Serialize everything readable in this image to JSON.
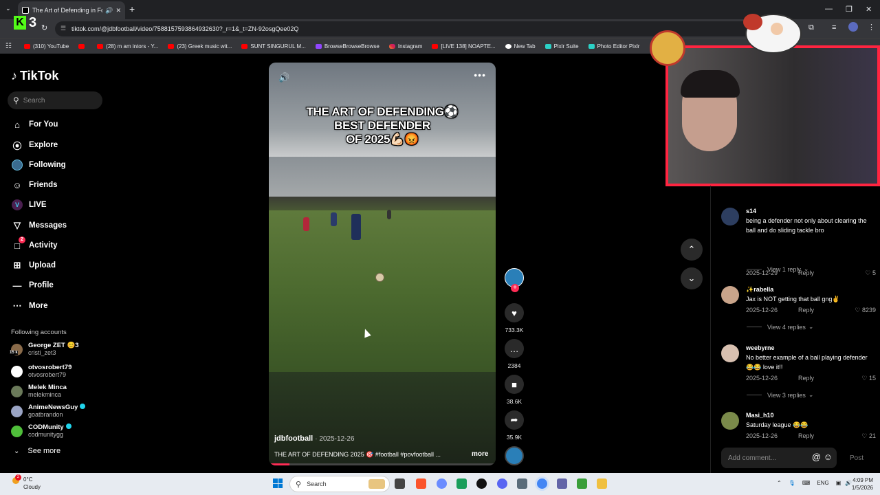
{
  "browser": {
    "tab_title": "The Art of Defending in Fo",
    "url": "tiktok.com/@jdbfootball/video/7588157593864932630?_r=1&_t=ZN-92osgQee02Q",
    "overlay_badge": "3",
    "bookmarks": [
      {
        "label": "(310) YouTube",
        "icon": "youtube-icon"
      },
      {
        "label": "",
        "icon": "youtube-icon"
      },
      {
        "label": "(28) m am intors - Y...",
        "icon": "youtube-icon"
      },
      {
        "label": "(23) Greek music wit...",
        "icon": "youtube-icon"
      },
      {
        "label": "SUNT SINGURUL M...",
        "icon": "youtube-icon"
      },
      {
        "label": "BrowseBrowseBrowse",
        "icon": "twitch-icon"
      },
      {
        "label": "Instagram",
        "icon": "instagram-icon"
      },
      {
        "label": "[LIVE 138] NOAPTE...",
        "icon": "youtube-icon"
      },
      {
        "label": "New Tab",
        "icon": "new-tab-icon"
      },
      {
        "label": "Pixlr Suite",
        "icon": "pixlr-icon"
      },
      {
        "label": "Photo Editor Pixlr",
        "icon": "pixlr-icon"
      }
    ]
  },
  "sidebar": {
    "logo": "TikTok",
    "search_placeholder": "Search",
    "nav": [
      {
        "label": "For You",
        "icon": "home-icon"
      },
      {
        "label": "Explore",
        "icon": "compass-icon"
      },
      {
        "label": "Following",
        "icon": "following-avatar"
      },
      {
        "label": "Friends",
        "icon": "friends-icon"
      },
      {
        "label": "LIVE",
        "icon": "live-icon"
      },
      {
        "label": "Messages",
        "icon": "messages-icon"
      },
      {
        "label": "Activity",
        "icon": "activity-icon",
        "badge": "2"
      },
      {
        "label": "Upload",
        "icon": "upload-icon"
      },
      {
        "label": "Profile",
        "icon": "profile-icon"
      },
      {
        "label": "More",
        "icon": "more-icon"
      }
    ],
    "following_title": "Following accounts",
    "accounts": [
      {
        "name": "George ZET 😊3",
        "handle": "cristi_zet3",
        "badge": "15 k"
      },
      {
        "name": "otvosrobert79",
        "handle": "otvosrobert79"
      },
      {
        "name": "Melek Minca",
        "handle": "melekminca"
      },
      {
        "name": "AnimeNewsGuy",
        "handle": "goatbrandon",
        "verified": true
      },
      {
        "name": "CODMunity",
        "handle": "codmunitygg",
        "verified": true
      }
    ],
    "see_more": "See more"
  },
  "video": {
    "title_lines": [
      "THE ART OF DEFENDING⚽",
      "BEST DEFENDER",
      "OF 2025💪🏻😡"
    ],
    "author": "jdbfootball",
    "date": "2025-12-26",
    "caption": "THE ART OF DEFENDING 2025 🎯 #football #povfootball ...",
    "more": "more",
    "progress": 0.09
  },
  "actions": {
    "likes": "733.3K",
    "comments": "2384",
    "saves": "38.6K",
    "shares": "35.9K"
  },
  "comments": [
    {
      "user": "s14",
      "text": "being a defender not only about clearing the ball and do sliding tackle bro",
      "date": "2025-12-29",
      "reply": "Reply",
      "likes": "5",
      "view_replies": "View 1 reply"
    },
    {
      "user": "✨rabella",
      "text": "Jax is NOT getting that ball gng✌️",
      "date": "2025-12-26",
      "reply": "Reply",
      "likes": "8239",
      "view_replies": "View 4 replies"
    },
    {
      "user": "weebyrne",
      "text": "No better example of a ball playing defender 😂😂 love it!!",
      "date": "2025-12-26",
      "reply": "Reply",
      "likes": "15",
      "view_replies": "View 3 replies"
    },
    {
      "user": "Masi_h10",
      "text": "Saturday league 😂😂",
      "date": "2025-12-26",
      "reply": "Reply",
      "likes": "21"
    }
  ],
  "comment_input": {
    "placeholder": "Add comment...",
    "post": "Post"
  },
  "taskbar": {
    "weather_temp": "0°C",
    "weather_desc": "Cloudy",
    "weather_badge": "2",
    "search": "Search",
    "lang": "ENG",
    "time": "4:09 PM",
    "date": "1/5/2026"
  },
  "colors": {
    "accent": "#fe2c55",
    "webcam_border": "#ff2440",
    "taskbar": "#e7ebf1"
  }
}
